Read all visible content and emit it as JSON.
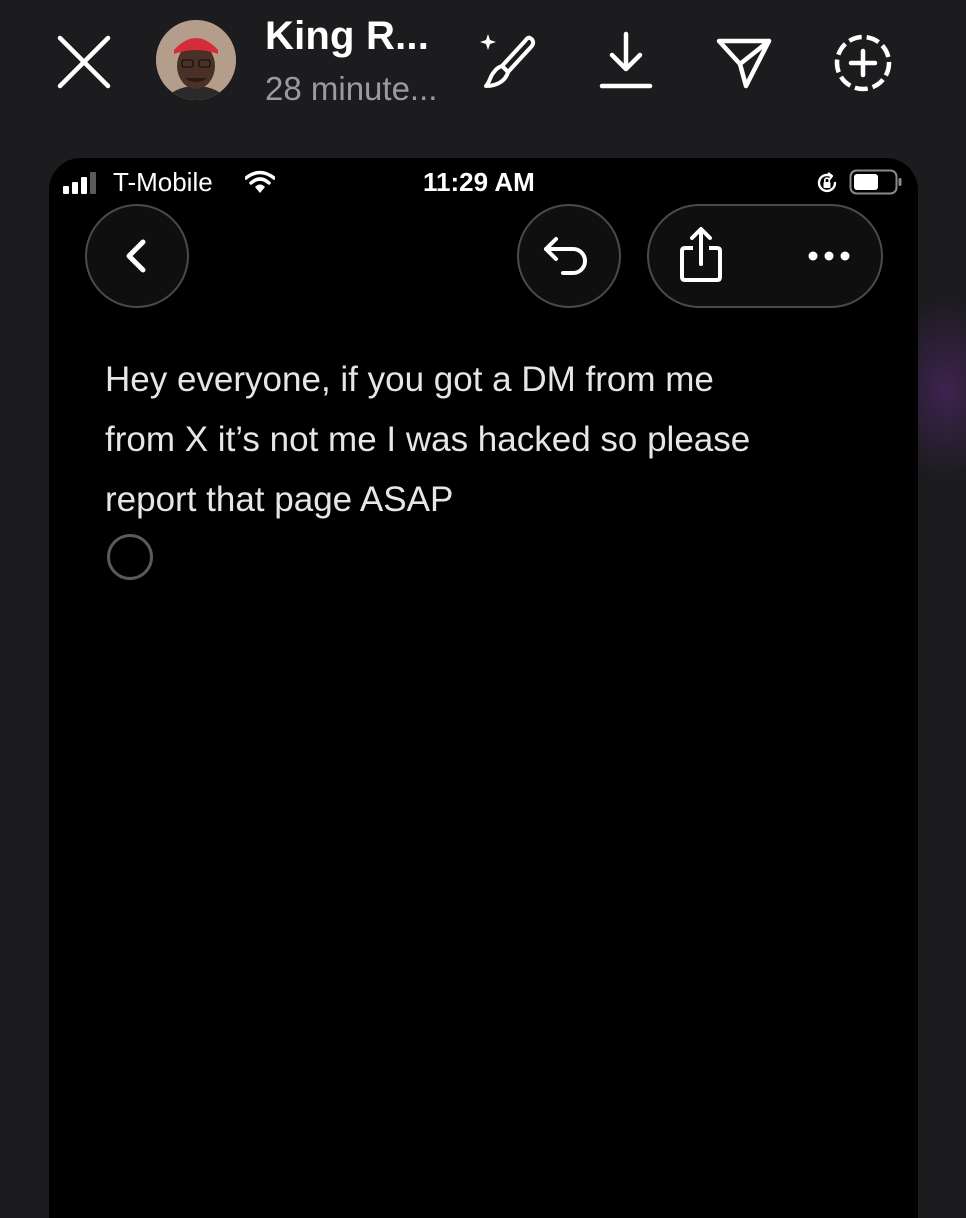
{
  "story_header": {
    "user_name": "King R...",
    "time_ago": "28 minute...",
    "icons": [
      "close-icon",
      "brush-sparkle-icon",
      "download-icon",
      "send-icon",
      "add-circle-icon"
    ]
  },
  "phone_screenshot": {
    "status_bar": {
      "carrier": "T-Mobile",
      "time": "11:29 AM",
      "icons": [
        "signal-icon",
        "wifi-icon",
        "orientation-lock-icon",
        "battery-icon"
      ]
    },
    "toolbar": {
      "icons": [
        "chevron-left-icon",
        "undo-icon",
        "share-icon",
        "more-icon"
      ]
    },
    "note": {
      "text": "Hey everyone, if you got a DM from me\nfrom X it’s not me I was hacked so please\nreport that page ASAP"
    }
  },
  "colors": {
    "page_background": "#1c1c1f",
    "phone_background": "#000000",
    "text_primary": "#ffffff",
    "text_secondary": "#9a9aa0",
    "button_border": "#4a4a4e"
  }
}
